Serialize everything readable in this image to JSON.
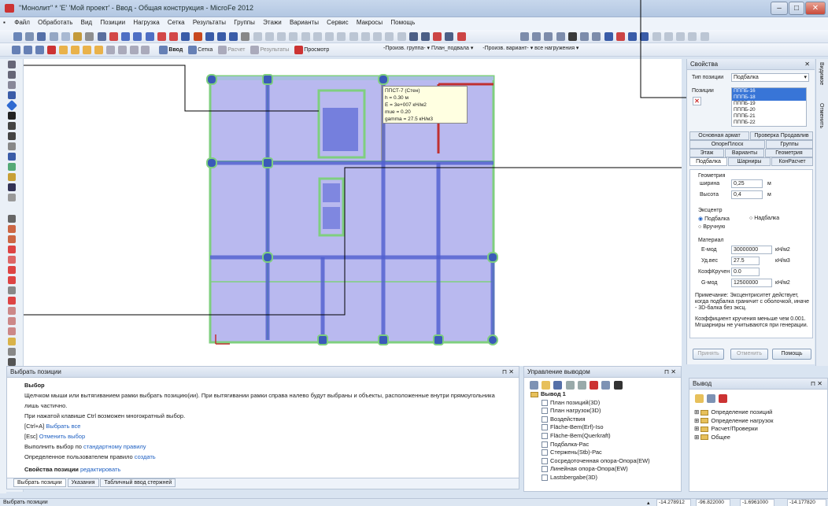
{
  "window": {
    "title": "\"Монолит\" * 'E' 'Мой проект' - Ввод - Общая конструкция - MicroFe 2012",
    "minimize": "–",
    "maximize": "□",
    "close": "✕"
  },
  "menu": [
    "Файл",
    "Обработать",
    "Вид",
    "Позиции",
    "Нагрузка",
    "Сетка",
    "Результаты",
    "Группы",
    "Этажи",
    "Варианты",
    "Сервис",
    "Макросы",
    "Помощь"
  ],
  "toolbar2": {
    "vvod": "Ввод",
    "setka": "Сетка",
    "raschet": "Расчет",
    "results": "Результаты",
    "prosmotr": "Просмотр",
    "group_select": "-Произв. группа-",
    "plan_select": "План_подвала",
    "variant_select": "-Произв. вариант-",
    "loads_select": "все нагружения"
  },
  "tooltip": [
    "ППСТ-7  (Стен)",
    "h = 0.30 м",
    "E = 3e+007 кН/м2",
    "mue = 0.20",
    "gamma = 27.5 кН/м3"
  ],
  "props": {
    "title": "Свойства",
    "type_label": "Тип позиции",
    "type_value": "Подбалка",
    "pos_label": "Позиции",
    "pos_list": [
      "ПППБ-16",
      "ПППБ-18",
      "ПППБ-19",
      "ПППБ-20",
      "ПППБ-21",
      "ПППБ-22"
    ],
    "tabs_row1": [
      "Основная армат",
      "Проверка Продавлив"
    ],
    "tabs_row2": [
      "ОпорнПлоск",
      "Группы"
    ],
    "tabs_row3": [
      "Этаж",
      "Варианты",
      "Геометрия"
    ],
    "tabs_row4": [
      "Подбалка",
      "Шарниры",
      "КонРасчет"
    ],
    "geom_title": "Геометрия",
    "width_label": "ширина",
    "width_value": "0,25",
    "width_unit": "м",
    "height_label": "Высота",
    "height_value": "0,4",
    "height_unit": "м",
    "ecc_title": "Эксцентр",
    "ecc_opt1": "Подбалка",
    "ecc_opt2": "Надбалка",
    "ecc_opt3": "Вручную",
    "mat_title": "Материал",
    "emod_label": "Е-мод",
    "emod_value": "30000000",
    "emod_unit": "кН/м2",
    "ud_label": "Уд.вес",
    "ud_value": "27.5",
    "ud_unit": "кН/м3",
    "kk_label": "КоэфКручен",
    "kk_value": "0.0",
    "gmod_label": "G-мод",
    "gmod_value": "12500000",
    "gmod_unit": "кН/м2",
    "note1": "Примечание: Эксцентриситет действует, когда подбалка граничит с оболочкой, иначе - 3D-балка без эксц.",
    "note2": "Коэффициент кручения меньше чем 0.001. Мгшарниры не учитываются при генерации.",
    "apply": "Принять",
    "cancel": "Отменить",
    "help": "Помощь"
  },
  "side_tabs": [
    "Видимое",
    "Отменить"
  ],
  "select_panel": {
    "title": "Выбрать позиции",
    "heading": "Выбор",
    "l1": "Щелчком мыши или вытягиванием рамки выбрать позицию(ии). При вытягивании рамки справа налево будут выбраны и объекты, расположенные внутри прямоугольника",
    "l2": "лишь частично.",
    "l3": "При нажатой клавише Ctrl возможен многократный выбор.",
    "l4a": "[Ctrl+A] ",
    "l4b": "Выбрать все",
    "l5a": "[Esc] ",
    "l5b": "Отменить выбор",
    "l6a": "Выполнить выбор по ",
    "l6b": "стандартному правилу",
    "l7a": "Определенное пользователем правило ",
    "l7b": "создать",
    "l8a": "Свойства позиции ",
    "l8b": "редактировать",
    "tabs": [
      "Выбрать позиции",
      "Указания",
      "Табличный ввод стержней"
    ]
  },
  "output_panel": {
    "title": "Управление выводом",
    "root": "Вывод 1",
    "items": [
      "План позиций(3D)",
      "План нагрузок(3D)",
      "Воздействия",
      "Fläche-Bem(Erf)-Iso",
      "Fläche-Bem(Querkraft)",
      "Подбалка-Рас",
      "Стержень(Stb)-Рас",
      "Сосредоточенная опора-Опора(EW)",
      "Линейная опора-Опора(EW)",
      "Lastsbergabe(3D)"
    ]
  },
  "vyvod_panel": {
    "title": "Вывод",
    "items": [
      "Определение позиций",
      "Определение нагрузок",
      "Расчет/Проверки",
      "Общее"
    ]
  },
  "status": {
    "text": "Выбрать позиции",
    "x_val": "-14.278912",
    "w_val": "-96.822000",
    "y_val": "-1.6961000",
    "z_val": "-14.177820"
  },
  "colors": {
    "slab": "#b9b9ef",
    "wall": "#7fcf7f",
    "beam": "#4f5fcf",
    "accent": "#1d5fc2"
  }
}
